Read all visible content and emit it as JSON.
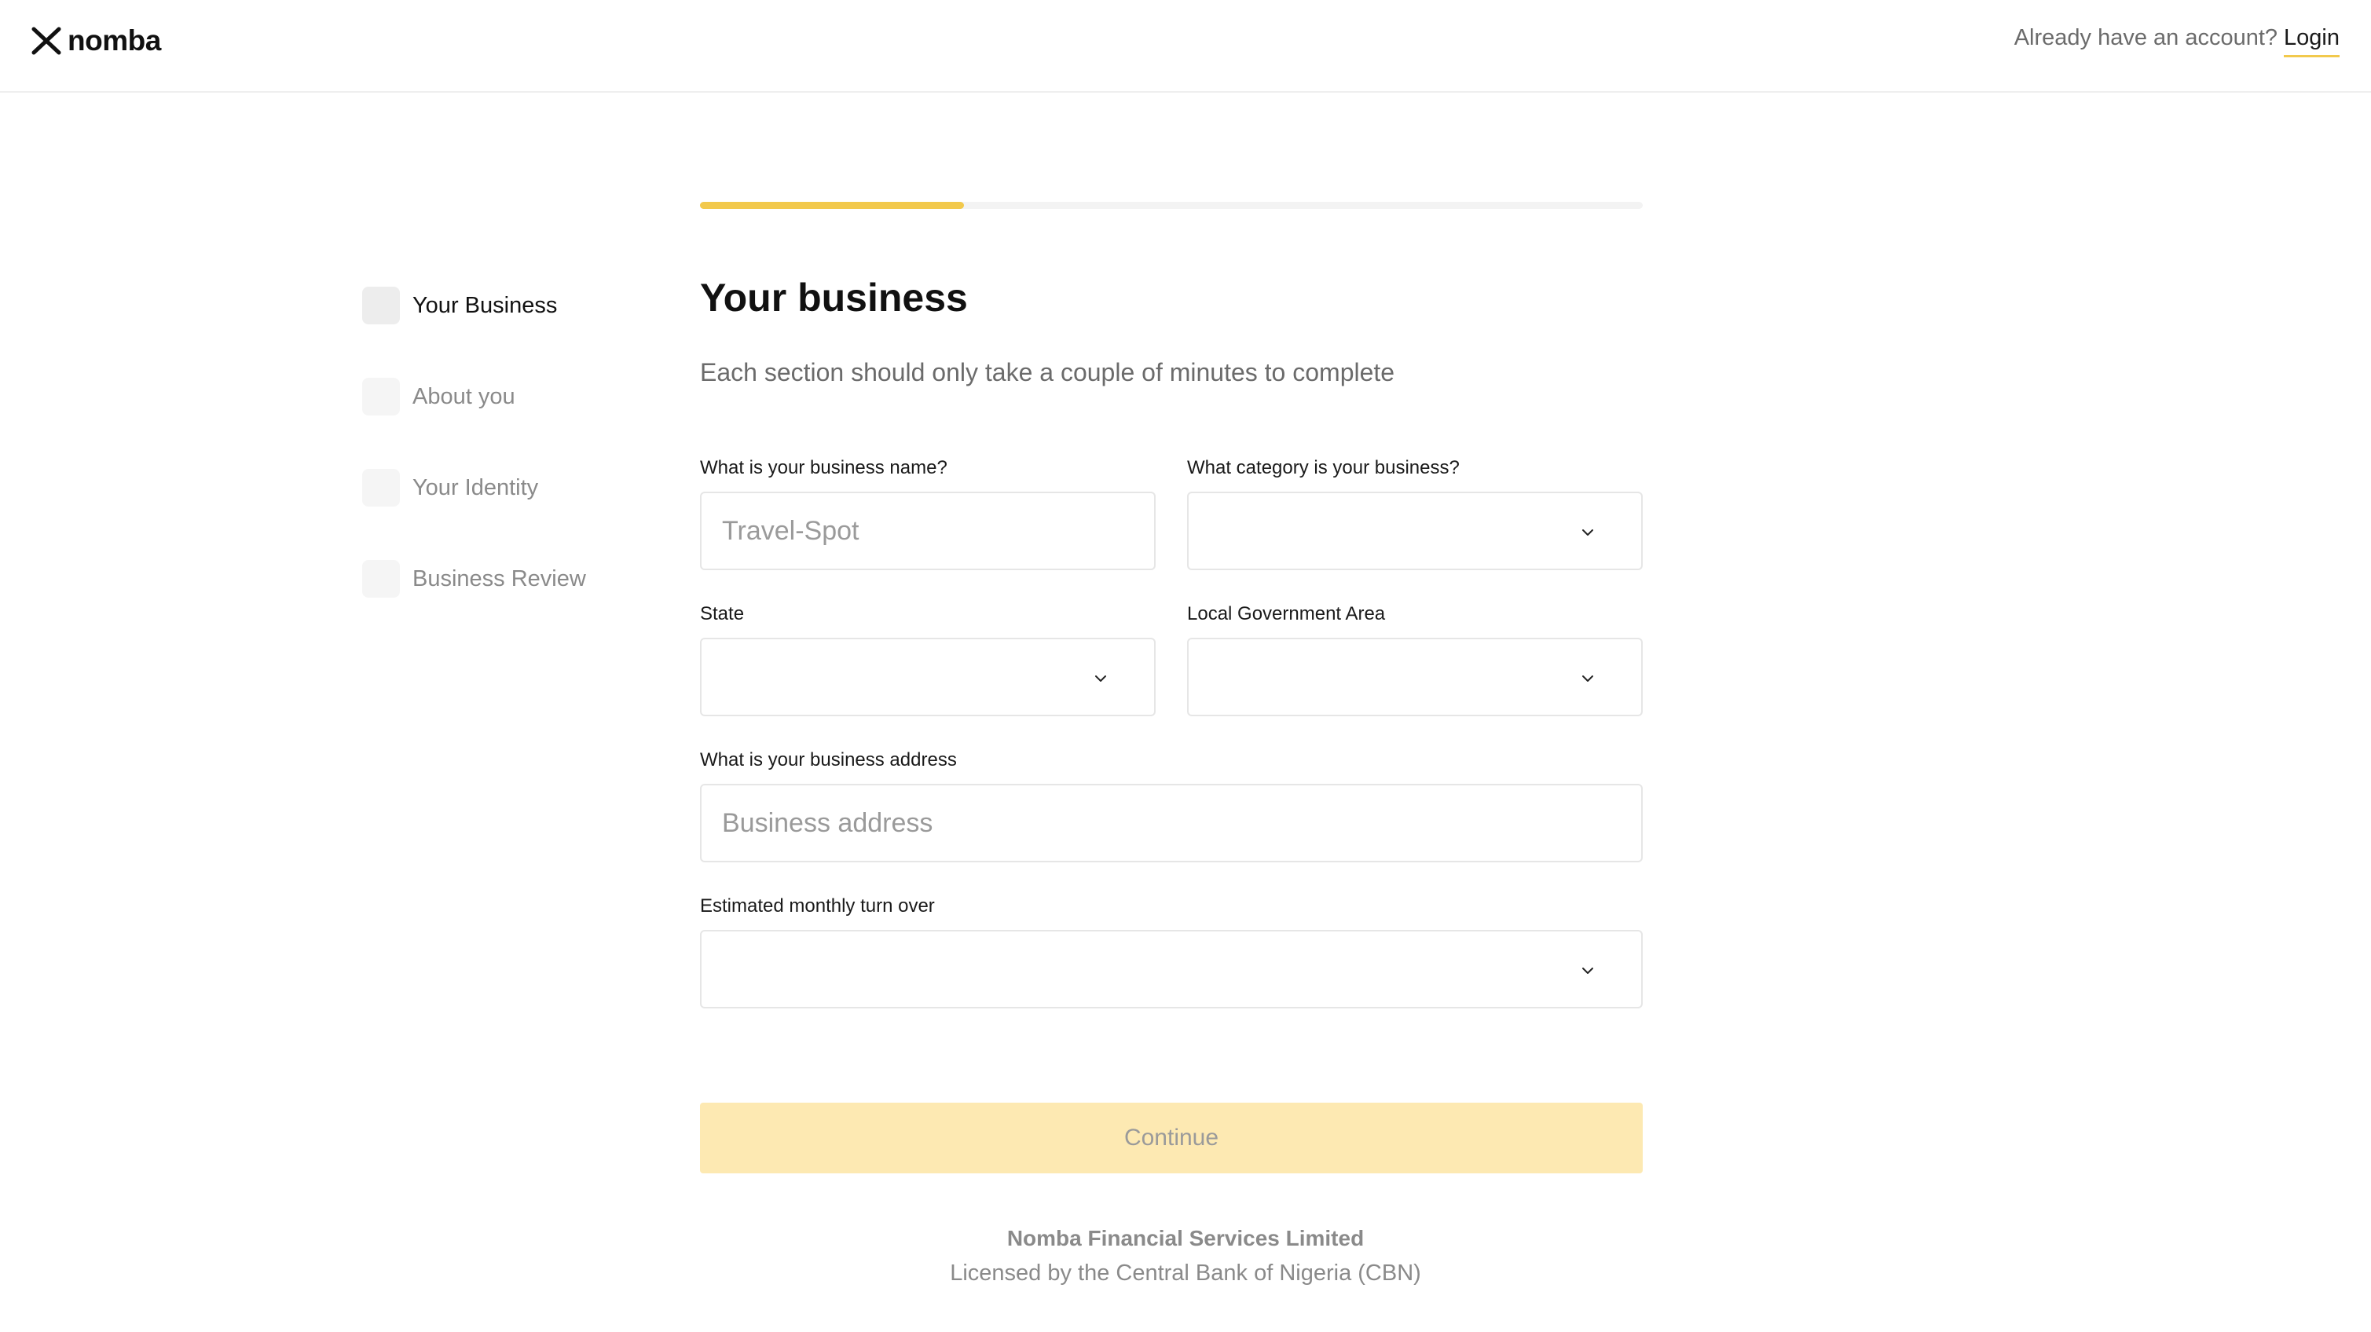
{
  "brand": {
    "name": "nomba",
    "logo_icon": "nomba-x-logo-icon",
    "accent": "#f2c94c"
  },
  "header": {
    "account_prompt": "Already have an account?",
    "login_label": "Login"
  },
  "progress": {
    "fraction": 0.28
  },
  "steps": [
    {
      "label": "Your Business",
      "active": true
    },
    {
      "label": "About you",
      "active": false
    },
    {
      "label": "Your Identity",
      "active": false
    },
    {
      "label": "Business Review",
      "active": false
    }
  ],
  "form": {
    "title": "Your business",
    "subtitle": "Each section should only take a couple of minutes to complete",
    "business_name": {
      "label": "What is your business name?",
      "placeholder": "Travel-Spot",
      "value": ""
    },
    "category": {
      "label": "What category is your business?",
      "value": ""
    },
    "state": {
      "label": "State",
      "value": ""
    },
    "lga": {
      "label": "Local Government Area",
      "value": ""
    },
    "address": {
      "label": "What is your business address",
      "placeholder": "Business address",
      "value": ""
    },
    "turnover": {
      "label": "Estimated monthly turn over",
      "value": ""
    },
    "continue_label": "Continue"
  },
  "footer": {
    "company": "Nomba Financial Services Limited",
    "license": "Licensed by the Central Bank of Nigeria (CBN)"
  }
}
